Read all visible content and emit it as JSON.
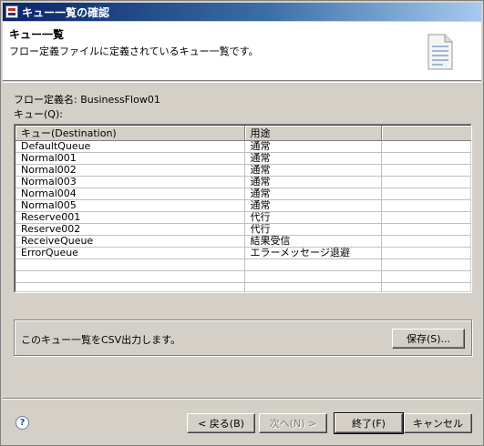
{
  "window": {
    "title": "キュー一覧の確認"
  },
  "banner": {
    "title": "キュー一覧",
    "description": "フロー定義ファイルに定義されているキュー一覧です。"
  },
  "flow": {
    "label": "フロー定義名:",
    "name": "BusinessFlow01"
  },
  "queue_label": "キュー(Q):",
  "table": {
    "columns": [
      "キュー(Destination)",
      "用途"
    ],
    "rows": [
      [
        "DefaultQueue",
        "通常"
      ],
      [
        "Normal001",
        "通常"
      ],
      [
        "Normal002",
        "通常"
      ],
      [
        "Normal003",
        "通常"
      ],
      [
        "Normal004",
        "通常"
      ],
      [
        "Normal005",
        "通常"
      ],
      [
        "Reserve001",
        "代行"
      ],
      [
        "Reserve002",
        "代行"
      ],
      [
        "ReceiveQueue",
        "結果受信"
      ],
      [
        "ErrorQueue",
        "エラーメッセージ退避"
      ]
    ]
  },
  "export": {
    "message": "このキュー一覧をCSV出力します。",
    "save_label": "保存(S)..."
  },
  "buttons": {
    "back": "< 戻る(B)",
    "next": "次へ(N) >",
    "finish": "終了(F)",
    "cancel": "キャンセル"
  },
  "icons": {
    "help": "help-icon",
    "document": "document-icon",
    "app": "app-icon"
  },
  "colors": {
    "title_bar": "#0a246a",
    "face": "#d4d0c8"
  }
}
